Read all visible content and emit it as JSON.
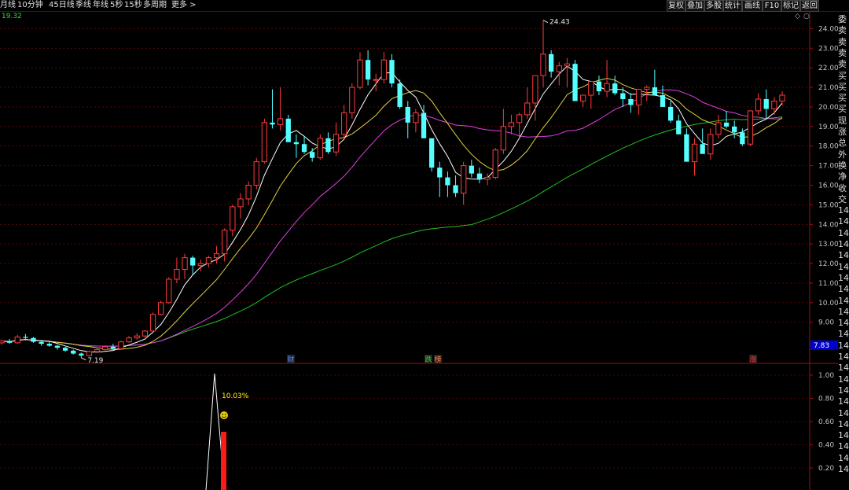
{
  "toolbar": {
    "periods": [
      "月线",
      "10分钟",
      "45日线",
      "季线",
      "年线",
      "5秒",
      "15秒",
      "多周期",
      "更多 >"
    ],
    "buttons": [
      "复权",
      "叠加",
      "多股",
      "统计",
      "画线",
      "F10",
      "标记",
      "返回"
    ]
  },
  "chart": {
    "top_left_value": "19.32",
    "price_axis_labels": [
      "24.00",
      "23.00",
      "22.00",
      "21.00",
      "20.00",
      "19.00",
      "18.00",
      "17.00",
      "16.00",
      "15.00",
      "14.00",
      "13.00",
      "12.00",
      "11.00",
      "10.00",
      "9.00"
    ],
    "current_price_tag": "7.83",
    "high_label": "24.43",
    "low_label": "7.19",
    "event_markers": [
      {
        "text": "财",
        "color": "#4f8cff"
      },
      {
        "text": "跌",
        "color": "#33cc33"
      },
      {
        "text": "榜",
        "color": "#ff8844"
      },
      {
        "text": "涨",
        "color": "#ff3333"
      }
    ]
  },
  "indicator": {
    "axis_labels": [
      "1.00",
      "0.80",
      "0.60",
      "0.40",
      "0.20"
    ],
    "peak_label": "10.03%"
  },
  "side_panel": {
    "items": [
      "委",
      "卖",
      "卖",
      "卖",
      "卖",
      "买",
      "买",
      "买",
      "买",
      "现",
      "涨",
      "总",
      "外",
      "换",
      "净",
      "收",
      "交",
      "14",
      "14",
      "14",
      "14",
      "14",
      "14",
      "14",
      "14",
      "14",
      "14",
      "14",
      "14",
      "14",
      "14",
      "14",
      "14",
      "14",
      "14",
      "14",
      "14",
      "14",
      "14",
      "14",
      "14"
    ]
  },
  "chart_data": {
    "type": "candlestick",
    "title": "",
    "ylim": [
      6.9,
      24.9
    ],
    "candles": [
      [
        7.95,
        8.1,
        7.85,
        8.05
      ],
      [
        8.05,
        8.15,
        7.9,
        7.95
      ],
      [
        7.95,
        8.35,
        7.9,
        8.25
      ],
      [
        8.25,
        8.4,
        8.1,
        8.2
      ],
      [
        8.2,
        8.25,
        7.95,
        8.0
      ],
      [
        8.0,
        8.05,
        7.8,
        7.9
      ],
      [
        7.9,
        8.0,
        7.75,
        7.8
      ],
      [
        7.8,
        7.85,
        7.6,
        7.7
      ],
      [
        7.7,
        7.75,
        7.5,
        7.55
      ],
      [
        7.55,
        7.6,
        7.35,
        7.4
      ],
      [
        7.4,
        7.45,
        7.19,
        7.3
      ],
      [
        7.3,
        7.55,
        7.25,
        7.5
      ],
      [
        7.5,
        7.7,
        7.45,
        7.6
      ],
      [
        7.6,
        7.8,
        7.55,
        7.75
      ],
      [
        7.75,
        7.9,
        7.6,
        7.65
      ],
      [
        7.65,
        8.05,
        7.6,
        8.0
      ],
      [
        8.0,
        8.3,
        7.95,
        8.2
      ],
      [
        8.2,
        8.45,
        8.1,
        8.3
      ],
      [
        8.3,
        8.6,
        8.2,
        8.55
      ],
      [
        8.55,
        9.5,
        8.5,
        9.4
      ],
      [
        9.4,
        10.1,
        9.35,
        10.0
      ],
      [
        10.0,
        11.3,
        9.95,
        11.2
      ],
      [
        11.2,
        12.3,
        11.0,
        11.7
      ],
      [
        11.7,
        12.5,
        11.2,
        12.3
      ],
      [
        12.3,
        12.4,
        11.4,
        11.9
      ],
      [
        11.9,
        12.2,
        11.6,
        12.0
      ],
      [
        12.0,
        12.4,
        11.8,
        12.3
      ],
      [
        12.3,
        12.9,
        12.0,
        12.5
      ],
      [
        12.5,
        13.8,
        12.1,
        13.7
      ],
      [
        13.7,
        15.0,
        13.4,
        14.9
      ],
      [
        14.9,
        15.6,
        14.3,
        15.3
      ],
      [
        15.3,
        16.2,
        15.0,
        16.0
      ],
      [
        16.0,
        17.4,
        15.8,
        17.2
      ],
      [
        17.2,
        19.4,
        17.1,
        19.2
      ],
      [
        19.2,
        20.9,
        18.9,
        19.1
      ],
      [
        19.1,
        21.0,
        18.8,
        19.4
      ],
      [
        19.4,
        19.6,
        18.3,
        18.2
      ],
      [
        18.2,
        18.6,
        17.4,
        18.1
      ],
      [
        18.1,
        18.5,
        17.6,
        17.7
      ],
      [
        17.7,
        17.9,
        17.2,
        17.4
      ],
      [
        17.4,
        18.6,
        17.3,
        18.4
      ],
      [
        18.4,
        18.7,
        17.6,
        17.7
      ],
      [
        17.7,
        19.2,
        17.5,
        18.6
      ],
      [
        18.6,
        20.1,
        18.3,
        19.7
      ],
      [
        19.7,
        21.2,
        19.4,
        21.0
      ],
      [
        21.0,
        22.8,
        20.9,
        22.4
      ],
      [
        22.4,
        22.9,
        21.1,
        21.4
      ],
      [
        21.4,
        21.7,
        20.8,
        21.4
      ],
      [
        21.4,
        22.8,
        21.2,
        22.4
      ],
      [
        22.4,
        22.7,
        21.0,
        21.2
      ],
      [
        21.2,
        21.4,
        19.9,
        20.0
      ],
      [
        20.0,
        20.3,
        18.4,
        19.2
      ],
      [
        19.2,
        19.9,
        18.7,
        19.7
      ],
      [
        19.7,
        20.1,
        18.4,
        18.4
      ],
      [
        18.4,
        17.9,
        16.7,
        16.9
      ],
      [
        16.9,
        17.2,
        15.4,
        16.4
      ],
      [
        16.4,
        16.7,
        15.4,
        16.0
      ],
      [
        16.0,
        16.5,
        15.4,
        15.6
      ],
      [
        15.6,
        17.2,
        15.0,
        17.0
      ],
      [
        17.0,
        17.3,
        16.4,
        16.6
      ],
      [
        16.6,
        16.9,
        16.1,
        16.3
      ],
      [
        16.3,
        16.6,
        16.0,
        16.4
      ],
      [
        16.4,
        17.9,
        16.3,
        17.8
      ],
      [
        17.8,
        19.9,
        17.6,
        19.0
      ],
      [
        19.0,
        19.6,
        18.6,
        19.2
      ],
      [
        19.2,
        19.7,
        18.4,
        19.6
      ],
      [
        19.6,
        21.0,
        19.4,
        20.2
      ],
      [
        20.2,
        21.0,
        19.3,
        21.6
      ],
      [
        21.6,
        24.43,
        21.0,
        22.7
      ],
      [
        22.7,
        22.9,
        21.5,
        21.8
      ],
      [
        21.8,
        22.3,
        21.1,
        22.1
      ],
      [
        22.1,
        22.5,
        21.0,
        22.2
      ],
      [
        22.2,
        22.4,
        20.7,
        20.3
      ],
      [
        20.3,
        20.6,
        20.0,
        20.6
      ],
      [
        20.6,
        20.8,
        19.9,
        21.3
      ],
      [
        21.3,
        21.6,
        20.6,
        20.8
      ],
      [
        20.8,
        22.4,
        20.5,
        21.2
      ],
      [
        21.2,
        21.6,
        20.6,
        20.7
      ],
      [
        20.7,
        21.0,
        20.0,
        20.4
      ],
      [
        20.4,
        20.7,
        19.7,
        20.1
      ],
      [
        20.1,
        20.6,
        19.6,
        20.9
      ],
      [
        20.9,
        21.1,
        20.3,
        21.0
      ],
      [
        21.0,
        21.9,
        20.7,
        20.6
      ],
      [
        20.6,
        21.1,
        20.3,
        20.0
      ],
      [
        20.0,
        20.3,
        19.2,
        19.3
      ],
      [
        19.3,
        19.6,
        18.6,
        18.6
      ],
      [
        18.6,
        18.9,
        17.3,
        17.2
      ],
      [
        17.2,
        18.4,
        16.5,
        18.1
      ],
      [
        18.1,
        18.9,
        17.7,
        17.6
      ],
      [
        17.6,
        18.9,
        17.3,
        18.6
      ],
      [
        18.6,
        19.6,
        18.4,
        19.2
      ],
      [
        19.2,
        19.8,
        18.9,
        19.0
      ],
      [
        19.0,
        19.3,
        18.4,
        18.7
      ],
      [
        18.7,
        18.9,
        18.0,
        18.1
      ],
      [
        18.1,
        19.8,
        18.0,
        19.8
      ],
      [
        19.8,
        20.7,
        19.6,
        20.4
      ],
      [
        20.4,
        20.9,
        19.4,
        19.9
      ],
      [
        19.9,
        20.5,
        19.6,
        20.3
      ],
      [
        20.3,
        20.8,
        20.1,
        20.6
      ]
    ]
  },
  "colors": {
    "up": "#ff3b3b",
    "down": "#54ffff",
    "ma5": "#ffffff",
    "ma10": "#e0d040",
    "ma20": "#e040e0",
    "ma60": "#20c020",
    "grid": "#7a1010",
    "axis": "#a01010",
    "indicator_line": "#ffffff",
    "indicator_bar": "#ff1a1a",
    "peak_label": "#ffff00",
    "price_tag_bg": "#0000cc"
  }
}
